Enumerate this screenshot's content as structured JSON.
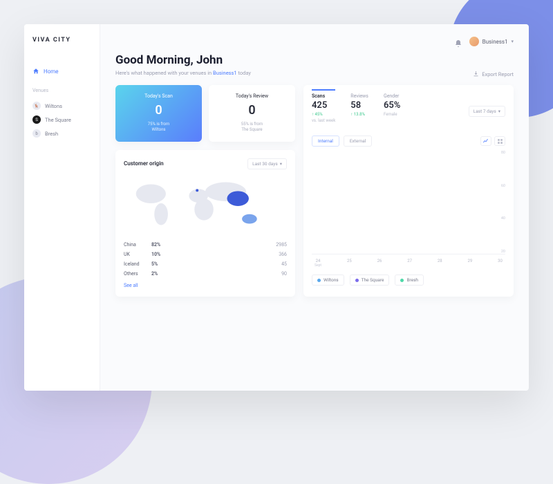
{
  "logo": "VIVA CITY",
  "nav": {
    "home": "Home",
    "venues_label": "Venues"
  },
  "venues": [
    {
      "name": "Wiltons"
    },
    {
      "name": "The Square"
    },
    {
      "name": "Bresh"
    }
  ],
  "topbar": {
    "username": "Business1"
  },
  "header": {
    "greeting": "Good Morning, John",
    "subline_pre": "Here's what happened with your venues in ",
    "subline_hl": "Business1",
    "subline_post": " today",
    "export": "Export Report"
  },
  "stats": {
    "scan": {
      "title": "Today's Scan",
      "value": "0",
      "sub1": "75% is from",
      "sub2": "Wiltons"
    },
    "review": {
      "title": "Today's Review",
      "value": "0",
      "sub1": "55% is from",
      "sub2": "The Square"
    }
  },
  "origin": {
    "title": "Customer origin",
    "range": "Last 30 days",
    "rows": [
      {
        "name": "China",
        "pct": "82%",
        "val": "2985"
      },
      {
        "name": "UK",
        "pct": "10%",
        "val": "366"
      },
      {
        "name": "Iceland",
        "pct": "5%",
        "val": "45"
      },
      {
        "name": "Others",
        "pct": "2%",
        "val": "90"
      }
    ],
    "see_all": "See all"
  },
  "chart": {
    "metrics": [
      {
        "label": "Scans",
        "value": "425",
        "delta": "↑ 45%",
        "sub": "vs. last week"
      },
      {
        "label": "Reviews",
        "value": "58",
        "delta": "↑ 13.8%",
        "sub": ""
      },
      {
        "label": "Gender",
        "value": "65%",
        "delta": "",
        "sub": "Female"
      }
    ],
    "range": "Last 7 days",
    "tabs": {
      "internal": "Internal",
      "external": "External"
    },
    "y_ticks": [
      "80",
      "60",
      "40",
      "20"
    ],
    "x_ticks": [
      "24",
      "25",
      "26",
      "27",
      "28",
      "29",
      "30"
    ],
    "x_month": "Sept",
    "legend": [
      "Wiltons",
      "The Square",
      "Bresh"
    ]
  },
  "chart_data": {
    "type": "line",
    "title": "Scans",
    "xlabel": "Sept",
    "ylabel": "",
    "ylim": [
      0,
      80
    ],
    "categories": [
      "24",
      "25",
      "26",
      "27",
      "28",
      "29",
      "30"
    ],
    "series": [
      {
        "name": "Wiltons",
        "values": [
          null,
          null,
          null,
          null,
          null,
          null,
          null
        ]
      },
      {
        "name": "The Square",
        "values": [
          null,
          null,
          null,
          null,
          null,
          null,
          null
        ]
      },
      {
        "name": "Bresh",
        "values": [
          null,
          null,
          null,
          null,
          null,
          null,
          null
        ]
      }
    ]
  }
}
